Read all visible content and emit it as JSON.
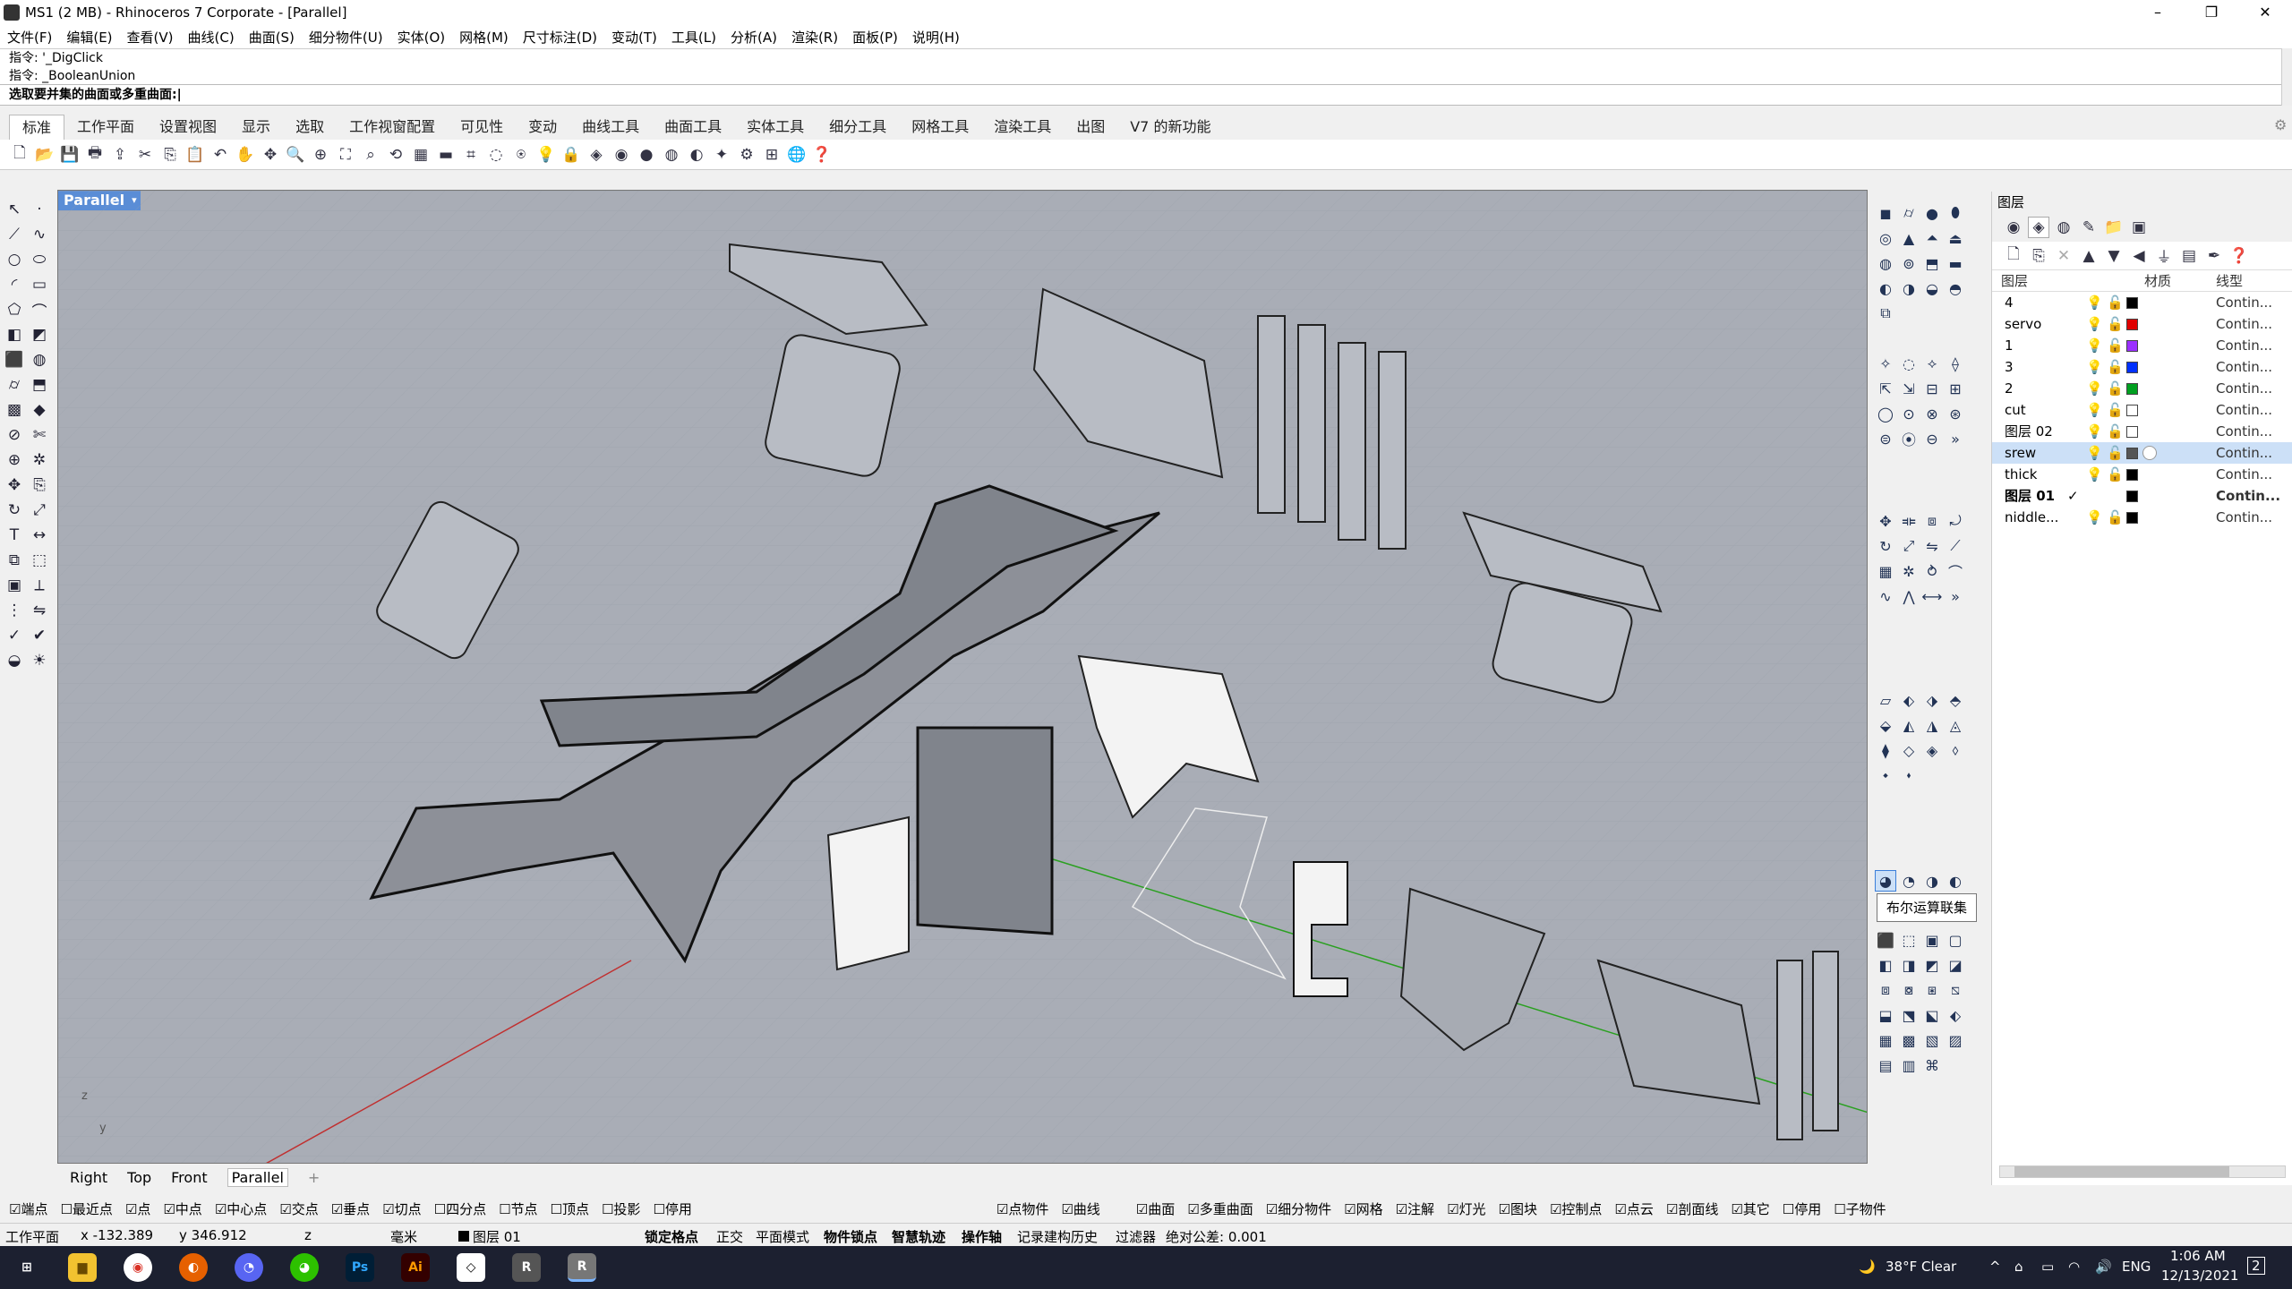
{
  "window": {
    "title": "MS1 (2 MB) - Rhinoceros 7 Corporate - [Parallel]",
    "min": "–",
    "max": "❐",
    "close": "✕"
  },
  "menu": [
    "文件(F)",
    "编辑(E)",
    "查看(V)",
    "曲线(C)",
    "曲面(S)",
    "细分物件(U)",
    "实体(O)",
    "网格(M)",
    "尺寸标注(D)",
    "变动(T)",
    "工具(L)",
    "分析(A)",
    "渲染(R)",
    "面板(P)",
    "说明(H)"
  ],
  "command": {
    "history": [
      "指令: '_DigClick",
      "指令: _BooleanUnion"
    ],
    "prompt": "选取要并集的曲面或多重曲面:"
  },
  "tabs": [
    "标准",
    "工作平面",
    "设置视图",
    "显示",
    "选取",
    "工作视窗配置",
    "可见性",
    "变动",
    "曲线工具",
    "曲面工具",
    "实体工具",
    "细分工具",
    "网格工具",
    "渲染工具",
    "出图",
    "V7 的新功能"
  ],
  "viewport": {
    "label": "Parallel",
    "dropdown": "▾"
  },
  "view_tabs": [
    "Right",
    "Top",
    "Front",
    "Parallel",
    "+"
  ],
  "tooltip": "布尔运算联集",
  "layers": {
    "panel_title": "图层",
    "col_name": "图层",
    "col_material": "材质",
    "col_linetype": "线型",
    "rows": [
      {
        "name": "4",
        "color": "#000000",
        "linetype": "Contin..."
      },
      {
        "name": "servo",
        "color": "#e00000",
        "linetype": "Contin..."
      },
      {
        "name": "1",
        "color": "#9b30ff",
        "linetype": "Contin..."
      },
      {
        "name": "3",
        "color": "#0030ff",
        "linetype": "Contin..."
      },
      {
        "name": "2",
        "color": "#00a020",
        "linetype": "Contin..."
      },
      {
        "name": "cut",
        "color": "#ffffff",
        "linetype": "Contin..."
      },
      {
        "name": "图层 02",
        "color": "#ffffff",
        "linetype": "Contin..."
      },
      {
        "name": "srew",
        "color": "#555555",
        "linetype": "Contin..."
      },
      {
        "name": "thick",
        "color": "#000000",
        "linetype": "Contin..."
      },
      {
        "name": "图层 01",
        "color": "#000000",
        "linetype": "Contin..."
      },
      {
        "name": "niddle...",
        "color": "#000000",
        "linetype": "Contin..."
      }
    ],
    "current_mark": "✓"
  },
  "osnap": [
    "☑端点",
    "☐最近点",
    "☑点",
    "☑中点",
    "☑中心点",
    "☑交点",
    "☑垂点",
    "☑切点",
    "☐四分点",
    "☐节点",
    "☐顶点",
    "☐投影",
    "☐停用"
  ],
  "filter": [
    "☑点物件",
    "☑曲线",
    "☑曲面",
    "☑多重曲面",
    "☑细分物件",
    "☑网格",
    "☑注解",
    "☑灯光",
    "☑图块",
    "☑控制点",
    "☑点云",
    "☑剖面线",
    "☑其它",
    "☐停用",
    "☐子物件"
  ],
  "status": {
    "cplane": "工作平面",
    "x": "x -132.389",
    "y": "y 346.912",
    "z": "z",
    "unit": "毫米",
    "layer": "图层 01",
    "grid_snap": "锁定格点",
    "ortho": "正交",
    "planar": "平面模式",
    "osnap": "物件锁点",
    "smarttrack": "智慧轨迹",
    "gumball": "操作轴",
    "history": "记录建构历史",
    "filter": "过滤器",
    "tolerance": "绝对公差: 0.001"
  },
  "taskbar": {
    "weather": "38°F  Clear",
    "lang": "ENG",
    "time": "1:06 AM",
    "date": "12/13/2021",
    "notif": "2"
  },
  "axis": {
    "z": "z",
    "y": "y"
  }
}
